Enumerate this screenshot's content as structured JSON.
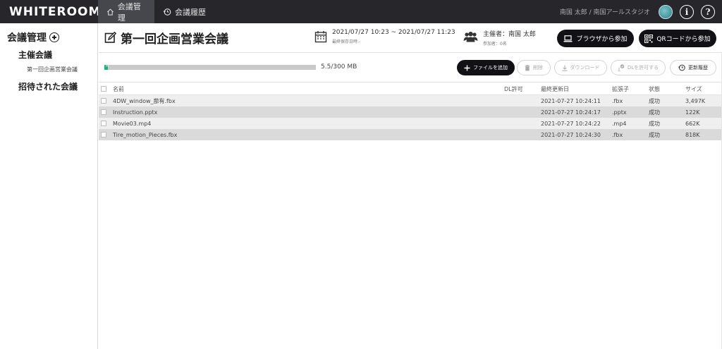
{
  "app": {
    "logo": "WHITEROOM"
  },
  "topnav": [
    {
      "label": "会議管理",
      "active": true
    },
    {
      "label": "会議履歴",
      "active": false
    }
  ],
  "user": {
    "display": "南国 太郎 / 南国アールスタジオ"
  },
  "sidebar": {
    "title": "会議管理",
    "hosted_label": "主催会議",
    "hosted_items": [
      "第一回企画営業会議"
    ],
    "invited_label": "招待された会議"
  },
  "meeting": {
    "title": "第一回企画営業会議",
    "datetime": "2021/07/27 10:23 ~ 2021/07/27 11:23",
    "last_saved": "最終保存日時:-",
    "host": "主催者：南国 太郎",
    "participants": "参加者：0名",
    "btn_browser": "ブラウザから参加",
    "btn_qr": "QRコードから参加"
  },
  "storage": {
    "used_label": "5.5/300 MB",
    "fill_fraction": 0.018,
    "fill_tag": "M"
  },
  "toolbar": {
    "add": "ファイルを追加",
    "delete": "削除",
    "download": "ダウンロード",
    "allow_dl": "DLを許可する",
    "history": "更新履歴"
  },
  "table": {
    "headers": {
      "name": "名前",
      "dl": "DL許可",
      "updated": "最終更新日",
      "ext": "拡張子",
      "status": "状態",
      "size": "サイズ"
    },
    "rows": [
      {
        "name": "4DW_window_蔀有.fbx",
        "dl": "",
        "updated": "2021-07-27 10:24:11",
        "ext": ".fbx",
        "status": "成功",
        "size": "3,497K"
      },
      {
        "name": "Instruction.pptx",
        "dl": "",
        "updated": "2021-07-27 10:24:17",
        "ext": ".pptx",
        "status": "成功",
        "size": "122K"
      },
      {
        "name": "Movie03.mp4",
        "dl": "",
        "updated": "2021-07-27 10:24:22",
        "ext": ".mp4",
        "status": "成功",
        "size": "662K"
      },
      {
        "name": "Tire_motion_Pieces.fbx",
        "dl": "",
        "updated": "2021-07-27 10:24:30",
        "ext": ".fbx",
        "status": "成功",
        "size": "818K"
      }
    ]
  },
  "colors": {
    "topbar": "#26262b",
    "accent": "#2aa879",
    "button_dark": "#121216"
  },
  "icons": [
    "home-icon",
    "history-icon",
    "info-icon",
    "help-icon",
    "plus-circle-icon",
    "edit-icon",
    "calendar-icon",
    "people-icon",
    "laptop-icon",
    "qr-icon",
    "plus-icon",
    "trash-icon",
    "download-icon",
    "check-download-icon",
    "history-refresh-icon"
  ]
}
